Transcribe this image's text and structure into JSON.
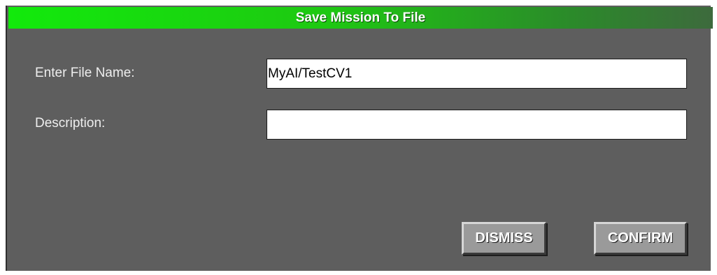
{
  "dialog": {
    "title": "Save Mission To File",
    "fields": {
      "file_name": {
        "label": "Enter File Name:",
        "value": "MyAI/TestCV1"
      },
      "description": {
        "label": "Description:",
        "value": ""
      }
    },
    "buttons": {
      "dismiss": "DISMISS",
      "confirm": "CONFIRM"
    }
  },
  "colors": {
    "title_bar_start": "#12ea0c",
    "panel_background": "#5e5e5e",
    "button_face": "#9a9a9a"
  }
}
